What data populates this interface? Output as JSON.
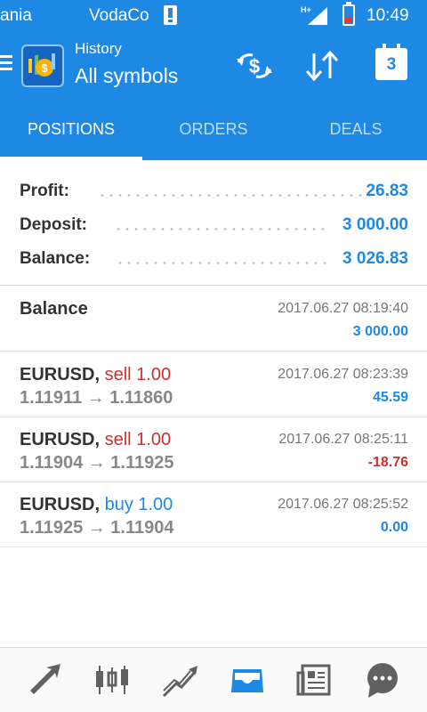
{
  "status_bar": {
    "carrier1": "ania",
    "carrier2": "VodaCo",
    "network": "H+",
    "time": "10:49"
  },
  "app_bar": {
    "title": "History",
    "subtitle": "All symbols",
    "calendar_day": "3",
    "accent_color": "#1e88e5"
  },
  "tabs": [
    {
      "label": "POSITIONS",
      "active": true
    },
    {
      "label": "ORDERS",
      "active": false
    },
    {
      "label": "DEALS",
      "active": false
    }
  ],
  "summary": {
    "profit_label": "Profit:",
    "profit_value": "26.83",
    "deposit_label": "Deposit:",
    "deposit_value": "3 000.00",
    "balance_label": "Balance:",
    "balance_value": "3 026.83"
  },
  "deals": [
    {
      "symbol": "Balance",
      "side": "",
      "side_type": "",
      "prices": "",
      "time": "2017.06.27 08:19:40",
      "profit": "3 000.00",
      "profit_type": "pos"
    },
    {
      "symbol": "EURUSD,",
      "side": "sell 1.00",
      "side_type": "sell",
      "prices": "1.11911 → 1.11860",
      "time": "2017.06.27 08:23:39",
      "profit": "45.59",
      "profit_type": "pos"
    },
    {
      "symbol": "EURUSD,",
      "side": "sell 1.00",
      "side_type": "sell",
      "prices": "1.11904 → 1.11925",
      "time": "2017.06.27 08:25:11",
      "profit": "-18.76",
      "profit_type": "neg"
    },
    {
      "symbol": "EURUSD,",
      "side": "buy 1.00",
      "side_type": "buy",
      "prices": "1.11925 → 1.11904",
      "time": "2017.06.27 08:25:52",
      "profit": "0.00",
      "profit_type": "pos"
    }
  ],
  "bottom_nav": [
    {
      "icon": "quotes-icon",
      "active": false
    },
    {
      "icon": "chart-icon",
      "active": false
    },
    {
      "icon": "trade-icon",
      "active": false
    },
    {
      "icon": "history-icon",
      "active": true
    },
    {
      "icon": "news-icon",
      "active": false
    },
    {
      "icon": "chat-icon",
      "active": false
    }
  ]
}
